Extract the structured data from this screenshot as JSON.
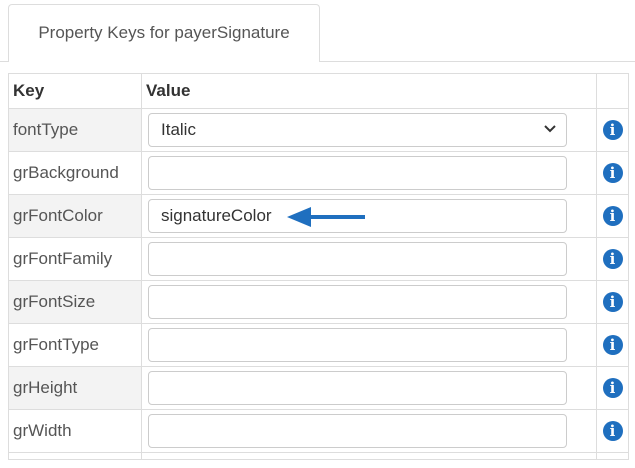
{
  "tab": {
    "label": "Property Keys for payerSignature"
  },
  "table": {
    "headers": {
      "key": "Key",
      "value": "Value"
    },
    "rows": [
      {
        "key": "fontType",
        "value": "Italic",
        "kind": "select"
      },
      {
        "key": "grBackground",
        "value": "",
        "kind": "input"
      },
      {
        "key": "grFontColor",
        "value": "signatureColor",
        "kind": "input"
      },
      {
        "key": "grFontFamily",
        "value": "",
        "kind": "input"
      },
      {
        "key": "grFontSize",
        "value": "",
        "kind": "input"
      },
      {
        "key": "grFontType",
        "value": "",
        "kind": "input"
      },
      {
        "key": "grHeight",
        "value": "",
        "kind": "input"
      },
      {
        "key": "grWidth",
        "value": "",
        "kind": "input"
      }
    ],
    "info_icon_glyph": "i"
  },
  "colors": {
    "accent": "#1f6fbf",
    "border": "#dddddd",
    "stripe": "#f3f3f3"
  },
  "icons": {
    "info": "info-circle-icon",
    "dropdown": "chevron-down-icon",
    "annotation": "arrow-left-icon"
  }
}
